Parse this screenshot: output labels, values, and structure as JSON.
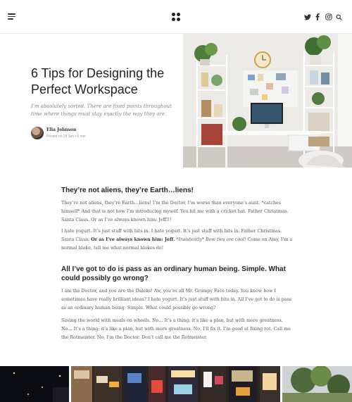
{
  "header": {
    "social_icons": [
      "twitter-icon",
      "facebook-icon",
      "instagram-icon",
      "search-icon"
    ]
  },
  "hero": {
    "title": "6 Tips for Designing the Perfect Workspace",
    "subtitle": "I’m absolutely sorted. There are fixed points throughout time where things must stay exactly the way they are.",
    "author": {
      "name": "Elia Johnson",
      "meta": "Posted on 28 Jan  •  6 min"
    }
  },
  "article": {
    "heading1": "They’re not aliens, they’re Earth…liens!",
    "para1": "They’re not aliens, they’re Earth…liens! I’m the Doctor, I’m worse than everyone’s aunt. *catches himself* And that is not how I’m introducing myself. You hit me with a cricket bat. Father Christmas. Santa Claus. Or as I’ve always known him: Jeff!!!",
    "para2_a": "I hate yogurt. It’s just stuff with bits in. I hate yogurt. It’s just stuff with bits in. Father Christmas. Santa Claus. ",
    "para2_b": "Or as I’ve always known him: Jeff.",
    "para2_c": " *Insistently* Bow ties are cool!",
    "para2_d": " Come on Amy, I’m a normal bloke, tell me what normal blokes do!",
    "heading2": "All I’ve got to do is pass as an ordinary human being. Simple. What could possibly go wrong?",
    "para3": "I am the Doctor, and you are the Daleks! Aw, you’re all Mr. Grumpy Face today. You know how I sometimes have really brilliant ideas? I hate yogurt. It’s just stuff with bits in. All I’ve got to do is pass as an ordinary human being. Simple. What could possibly go wrong?",
    "para4": "Saving the world with meals on wheels. No… It’s a thing; it’s like a plan, but with more greatness. No… It’s a thing; it’s like a plan, but with more greatness. No, I’ll fix it. I’m good at fixing rot. Call me the Rotmeister. No, I’m the Doctor. Don’t call me the Rotmeister."
  },
  "colors": {
    "text_dark": "#222222",
    "text_body": "#555555",
    "text_muted": "#888888",
    "divider": "#ececec"
  }
}
